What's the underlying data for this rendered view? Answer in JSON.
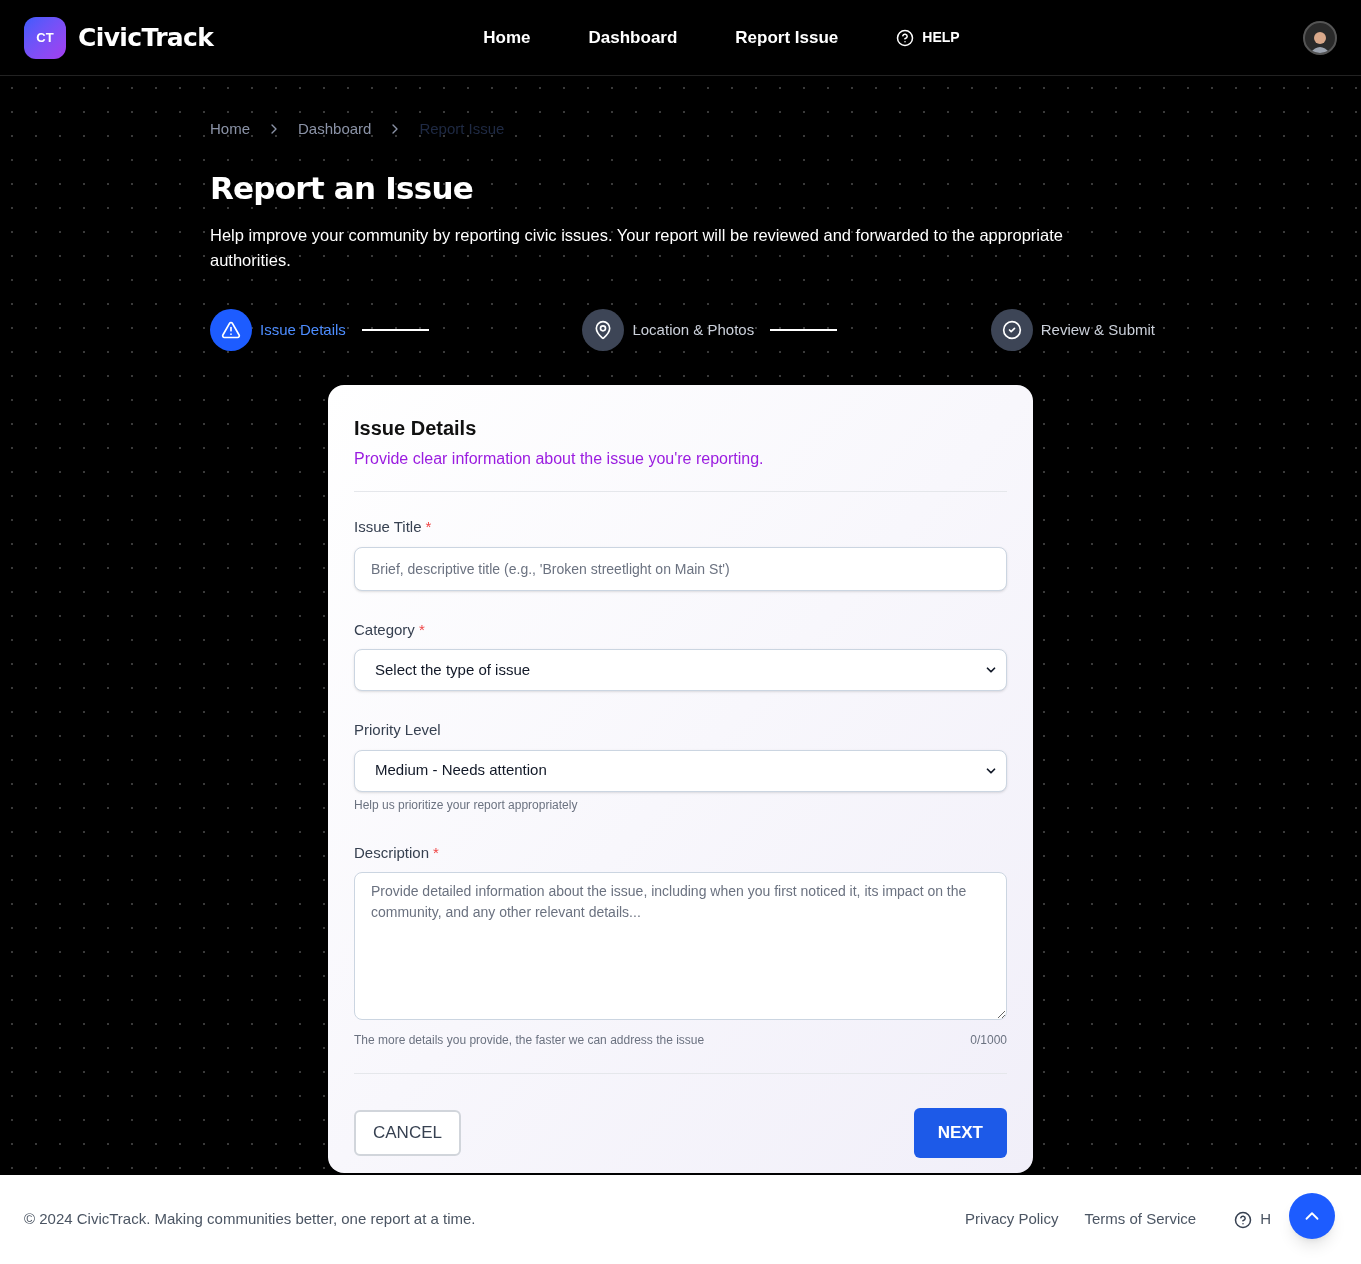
{
  "header": {
    "logo_mark": "CT",
    "brand": "CivicTrack",
    "nav": [
      {
        "label": "Home",
        "kind": "link"
      },
      {
        "label": "Dashboard",
        "kind": "link"
      },
      {
        "label": "Report Issue",
        "kind": "link"
      },
      {
        "label": "HELP",
        "kind": "help"
      }
    ]
  },
  "breadcrumb": [
    {
      "label": "Home",
      "selected": false
    },
    {
      "label": "Dashboard",
      "selected": false
    },
    {
      "label": "Report Issue",
      "selected": true
    }
  ],
  "page": {
    "title": "Report an Issue",
    "intro": "Help improve your community by reporting civic issues. Your report will be reviewed and forwarded to the appropriate authorities."
  },
  "steps": [
    {
      "label": "Issue Details",
      "kind": "alert",
      "selected": true
    },
    {
      "label": "Location & Photos",
      "kind": "pin",
      "selected": false
    },
    {
      "label": "Review & Submit",
      "kind": "check",
      "selected": false
    }
  ],
  "form": {
    "title": "Issue Details",
    "subtitle": "Provide clear information about the issue you're reporting.",
    "fields": [
      {
        "kind": "text",
        "label": "Issue Title",
        "required_mark": "*",
        "placeholder": "Brief, descriptive title (e.g., 'Broken streetlight on Main St')"
      },
      {
        "kind": "select",
        "label": "Category",
        "required_mark": "*",
        "value": "Select the type of issue"
      },
      {
        "kind": "select",
        "label": "Priority Level",
        "value": "Medium - Needs attention",
        "hint": "Help us prioritize your report appropriately"
      },
      {
        "kind": "textarea",
        "label": "Description",
        "required_mark": "*",
        "placeholder": "Provide detailed information about the issue, including when you first noticed it, its impact on the community, and any other relevant details...",
        "hint": "The more details you provide, the faster we can address the issue",
        "counter": "0/1000"
      }
    ],
    "cancel": "CANCEL",
    "next": "NEXT"
  },
  "footer": {
    "copyright": "© 2024 CivicTrack. Making communities better, one report at a time.",
    "links": [
      "Privacy Policy",
      "Terms of Service"
    ],
    "help": "H"
  }
}
